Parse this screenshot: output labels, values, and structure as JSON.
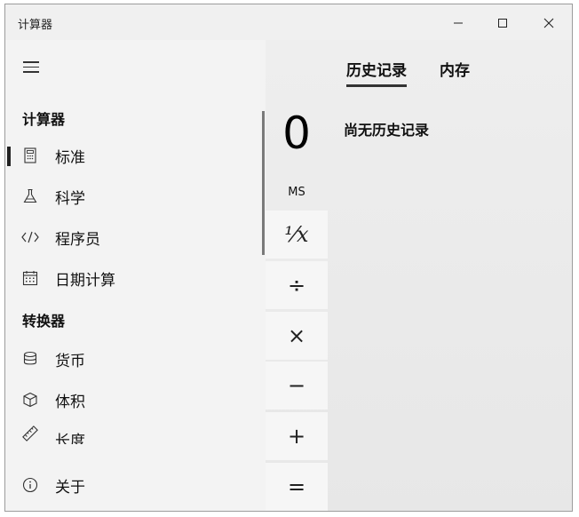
{
  "titlebar": {
    "title": "计算器",
    "minimize_icon": "minimize-icon",
    "maximize_icon": "maximize-icon",
    "close_icon": "close-icon"
  },
  "nav": {
    "menu_icon": "hamburger-menu-icon",
    "section_calculator": "计算器",
    "calculator_items": [
      {
        "label": "标准",
        "icon": "calculator-icon",
        "selected": true
      },
      {
        "label": "科学",
        "icon": "flask-icon",
        "selected": false
      },
      {
        "label": "程序员",
        "icon": "code-icon",
        "selected": false
      },
      {
        "label": "日期计算",
        "icon": "calendar-icon",
        "selected": false
      }
    ],
    "section_converter": "转换器",
    "converter_items": [
      {
        "label": "货币",
        "icon": "currency-icon"
      },
      {
        "label": "体积",
        "icon": "cube-icon"
      },
      {
        "label": "长度",
        "icon": "ruler-icon"
      }
    ],
    "about": {
      "label": "关于",
      "icon": "info-icon"
    }
  },
  "calculator": {
    "display": "0",
    "ms_label": "MS",
    "keys": [
      "¹⁄x",
      "÷",
      "×",
      "−",
      "+",
      "="
    ]
  },
  "history": {
    "tabs": [
      "历史记录",
      "内存"
    ],
    "active_tab": "历史记录",
    "empty_message": "尚无历史记录"
  },
  "colors": {
    "window_bg": "#ececec",
    "nav_bg": "#f3f3f3",
    "key_bg": "#f6f6f6",
    "accent": "#222222"
  }
}
